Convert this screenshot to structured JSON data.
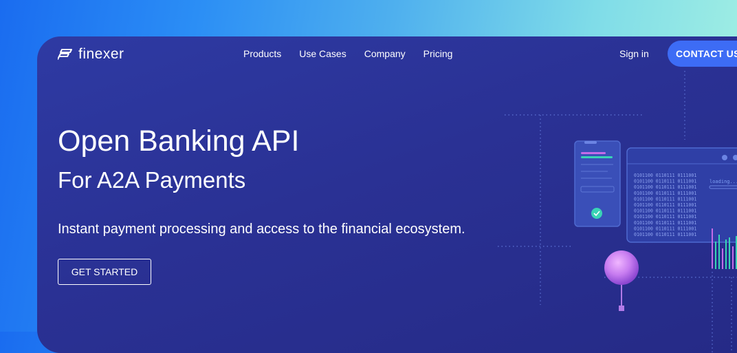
{
  "brand": {
    "name": "finexer"
  },
  "nav": {
    "links": [
      "Products",
      "Use Cases",
      "Company",
      "Pricing"
    ],
    "signin": "Sign in",
    "contact": "CONTACT US"
  },
  "hero": {
    "title": "Open Banking API",
    "subtitle": "For A2A Payments",
    "description": "Instant payment processing and access to the financial ecosystem.",
    "cta": "GET STARTED"
  },
  "illustration": {
    "loading_label": "loading....",
    "binary_line": "0101100 0110111 0111001"
  },
  "colors": {
    "background_start": "#1a6cf0",
    "background_end": "#a7f2e2",
    "card": "#2a3194",
    "accent_button": "#3d6cf5",
    "sphere": "#c77cf0",
    "chart_bars": "#39d3b5"
  }
}
